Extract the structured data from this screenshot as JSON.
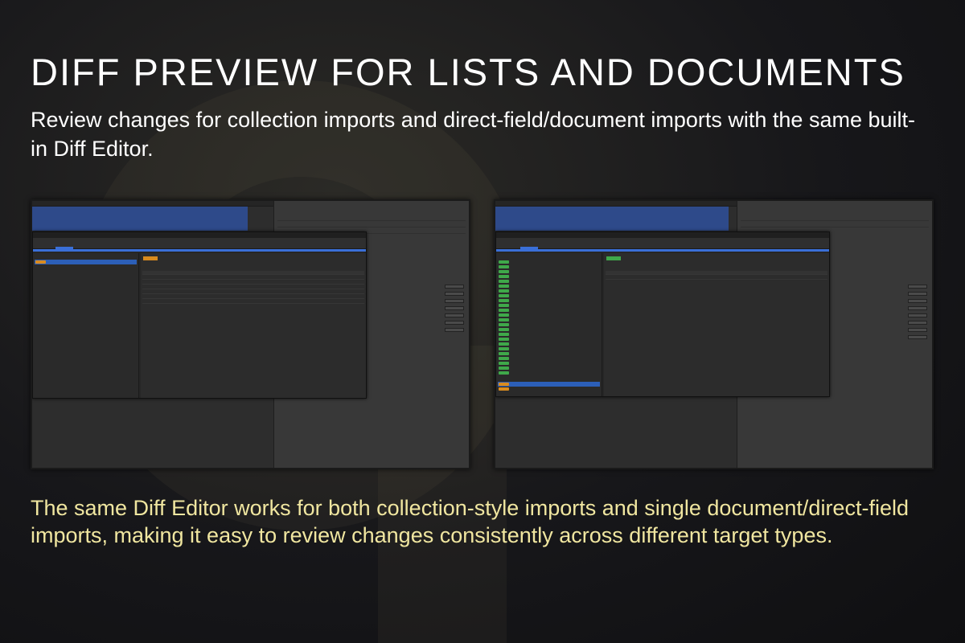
{
  "headline": "DIFF PREVIEW FOR LISTS AND DOCUMENTS",
  "subtitle": "Review changes for collection imports and direct-field/document imports with the same built-in Diff Editor.",
  "caption": "The same Diff Editor works for both collection-style imports and single document/direct-field imports, making it easy to review changes consistently across different target types.",
  "colors": {
    "accent_blue": "#3a6fd8",
    "added_green": "#3fa84a",
    "updated_orange": "#d98b1f",
    "caption_yellow": "#f0e6a0"
  }
}
